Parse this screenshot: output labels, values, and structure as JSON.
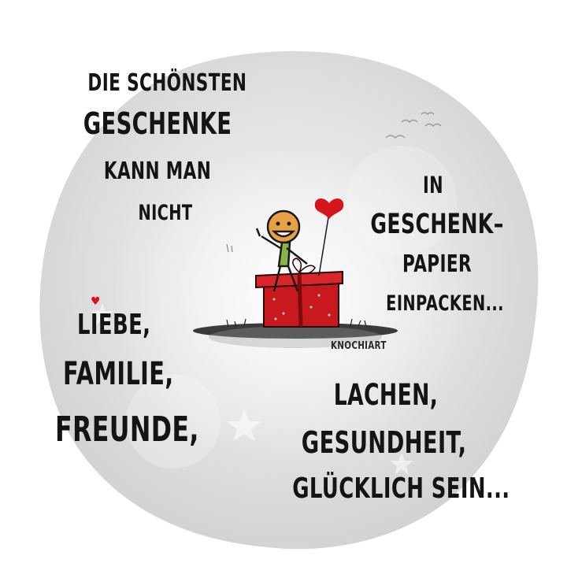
{
  "quote": {
    "line1": "DIE SCHÖNSTEN",
    "line2": "GESCHENKE",
    "line3": "KANN MAN",
    "line4": "NICHT",
    "right1": "IN",
    "right2": "GESCHENK–",
    "right3": "PAPIER",
    "right4": "EINPACKEN...",
    "left_list": [
      "LIEBE,",
      "FAMILIE,",
      "FREUNDE,"
    ],
    "right_list": [
      "LACHEN,",
      "GESUNDHEIT,",
      "GLÜCKLICH SEIN..."
    ]
  },
  "signature": "KNOCHIART",
  "colors": {
    "heart": "#d5141b",
    "gift": "#c8191f",
    "text": "#141414",
    "wash": "#e2e2e2"
  },
  "icons": [
    "heart-icon",
    "gift-box-icon",
    "stick-figure-icon",
    "balloon-heart-icon",
    "bird-icon"
  ]
}
